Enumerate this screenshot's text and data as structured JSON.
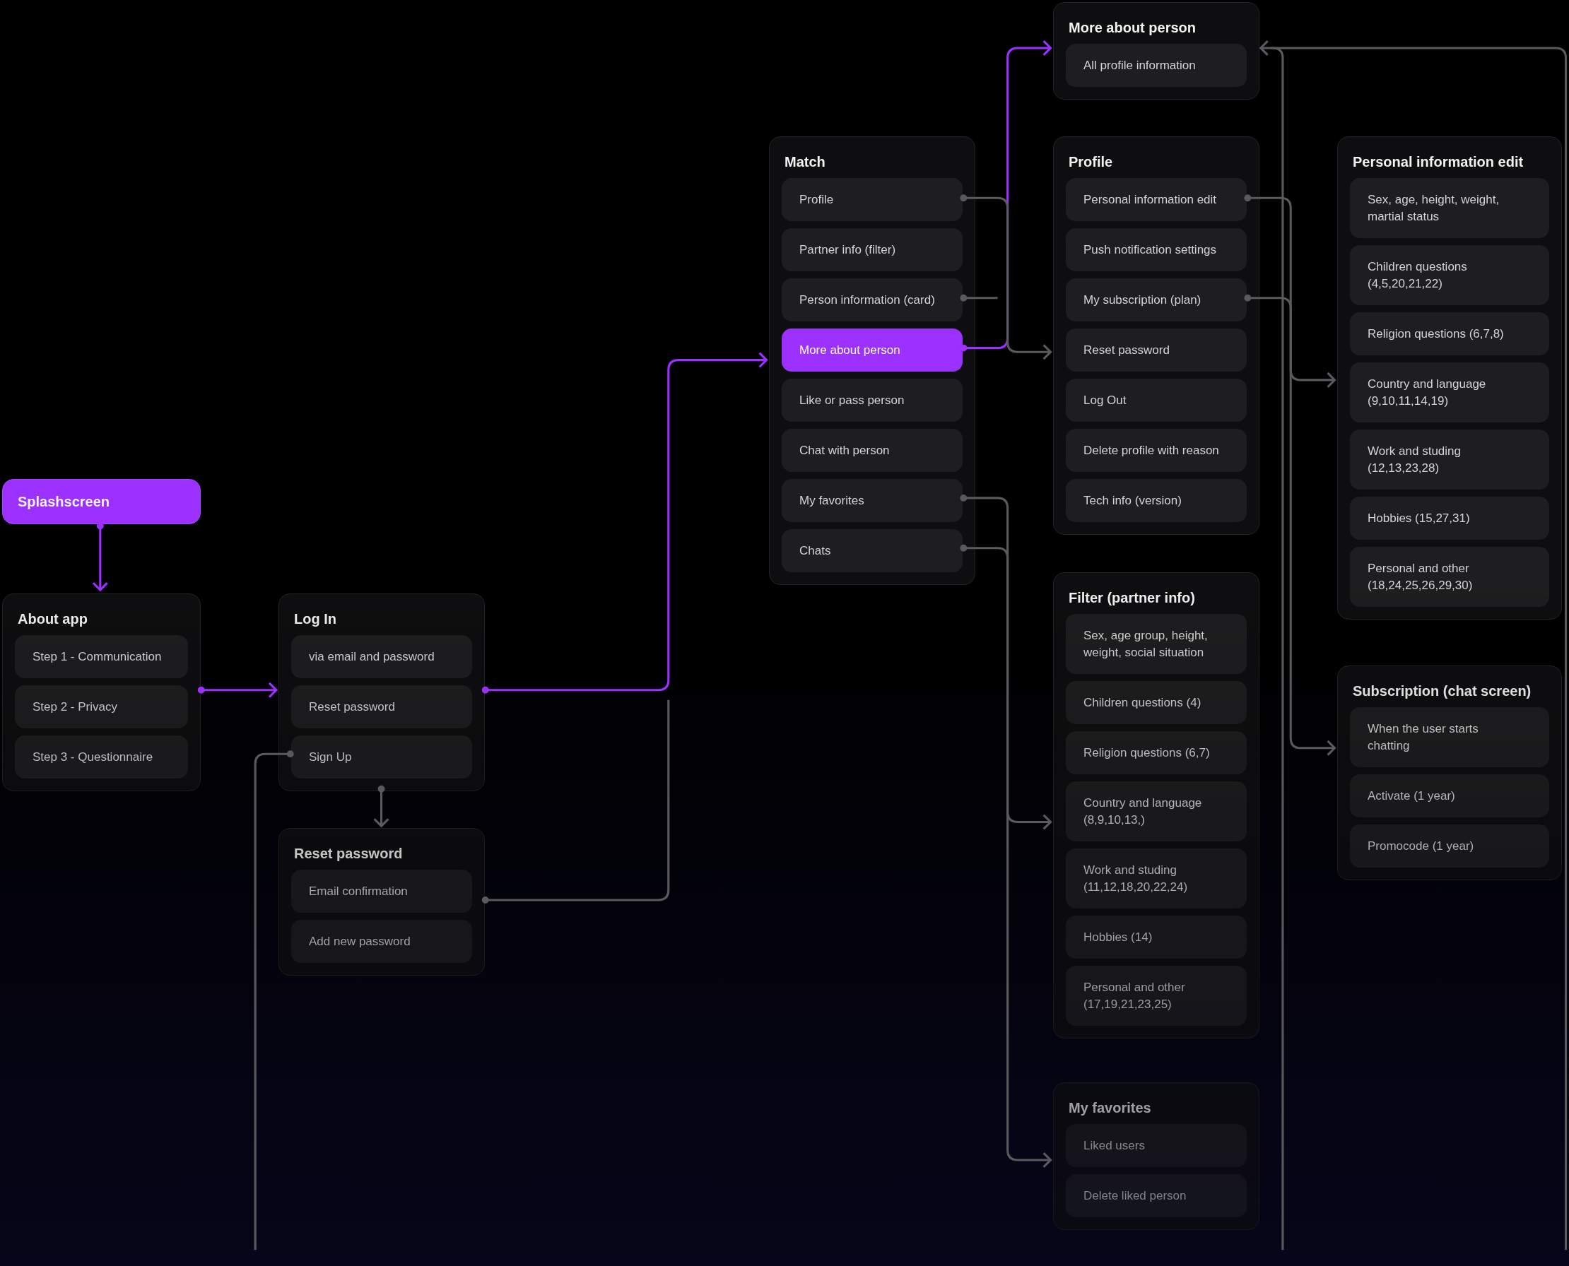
{
  "cards": [
    {
      "kind": "start",
      "title": "Splashscreen"
    },
    {
      "kind": "screen",
      "title": "About app",
      "items": [
        {
          "label": "Step 1 - Communication",
          "selected": false
        },
        {
          "label": "Step 2 - Privacy",
          "selected": false
        },
        {
          "label": "Step 3 - Questionnaire",
          "selected": false
        }
      ]
    },
    {
      "kind": "screen",
      "title": "Log In",
      "items": [
        {
          "label": "via email and password",
          "selected": false
        },
        {
          "label": "Reset password",
          "selected": false
        },
        {
          "label": "Sign Up",
          "selected": false
        }
      ]
    },
    {
      "kind": "screen",
      "title": "Reset password",
      "items": [
        {
          "label": "Email confirmation",
          "selected": false
        },
        {
          "label": "Add new password",
          "selected": false
        }
      ]
    },
    {
      "kind": "screen",
      "title": "Match",
      "items": [
        {
          "label": "Profile",
          "selected": false
        },
        {
          "label": "Partner info (filter)",
          "selected": false
        },
        {
          "label": "Person information (card)",
          "selected": false
        },
        {
          "label": "More about person",
          "selected": true
        },
        {
          "label": "Like or pass person",
          "selected": false
        },
        {
          "label": "Chat with person",
          "selected": false
        },
        {
          "label": "My favorites",
          "selected": false
        },
        {
          "label": "Chats",
          "selected": false
        }
      ]
    },
    {
      "kind": "screen",
      "title": "More about person",
      "items": [
        {
          "label": "All profile information",
          "selected": false
        }
      ]
    },
    {
      "kind": "screen",
      "title": "Profile",
      "items": [
        {
          "label": "Personal information edit",
          "selected": false
        },
        {
          "label": "Push notification settings",
          "selected": false
        },
        {
          "label": "My subscription (plan)",
          "selected": false
        },
        {
          "label": "Reset password",
          "selected": false
        },
        {
          "label": "Log Out",
          "selected": false
        },
        {
          "label": "Delete profile with reason",
          "selected": false
        },
        {
          "label": "Tech info (version)",
          "selected": false
        }
      ]
    },
    {
      "kind": "screen",
      "title": "Filter (partner info)",
      "items": [
        {
          "label": "Sex, age group, height,\nweight, social situation",
          "selected": false
        },
        {
          "label": "Children questions (4)",
          "selected": false
        },
        {
          "label": "Religion questions (6,7)",
          "selected": false
        },
        {
          "label": "Country and language\n(8,9,10,13,)",
          "selected": false
        },
        {
          "label": "Work and studing\n(11,12,18,20,22,24)",
          "selected": false
        },
        {
          "label": "Hobbies (14)",
          "selected": false
        },
        {
          "label": "Personal and other\n(17,19,21,23,25)",
          "selected": false
        }
      ]
    },
    {
      "kind": "screen",
      "title": "My favorites",
      "items": [
        {
          "label": "Liked users",
          "selected": false
        },
        {
          "label": "Delete liked person",
          "selected": false
        }
      ]
    },
    {
      "kind": "screen",
      "title": "Personal information edit",
      "items": [
        {
          "label": "Sex, age, height, weight,\nmartial status",
          "selected": false
        },
        {
          "label": "Children questions\n(4,5,20,21,22)",
          "selected": false
        },
        {
          "label": "Religion questions (6,7,8)",
          "selected": false
        },
        {
          "label": "Country and language\n(9,10,11,14,19)",
          "selected": false
        },
        {
          "label": "Work and studing\n(12,13,23,28)",
          "selected": false
        },
        {
          "label": "Hobbies (15,27,31)",
          "selected": false
        },
        {
          "label": "Personal and other\n(18,24,25,26,29,30)",
          "selected": false
        }
      ]
    },
    {
      "kind": "screen",
      "title": "Subscription (chat screen)",
      "items": [
        {
          "label": "When the user starts\nchatting",
          "selected": false
        },
        {
          "label": "Activate (1 year)",
          "selected": false
        },
        {
          "label": "Promocode (1 year)",
          "selected": false
        }
      ]
    }
  ],
  "connectors": [
    {
      "color": "#9b30ff"
    },
    {
      "color": "#9b30ff"
    },
    {
      "color": "#9b30ff"
    },
    {
      "color": "#5a5a5e"
    },
    {
      "color": "#5a5a5e"
    },
    {
      "color": "#5a5a5e"
    },
    {
      "color": "#9b30ff"
    },
    {
      "color": "#5a5a5e"
    },
    {
      "color": "#5a5a5e"
    },
    {
      "color": "#5a5a5e"
    },
    {
      "color": "#5a5a5e"
    },
    {
      "color": "#5a5a5e"
    },
    {
      "color": "#5a5a5e"
    },
    {
      "color": "#5a5a5e"
    },
    {
      "color": "#5a5a5e"
    }
  ]
}
